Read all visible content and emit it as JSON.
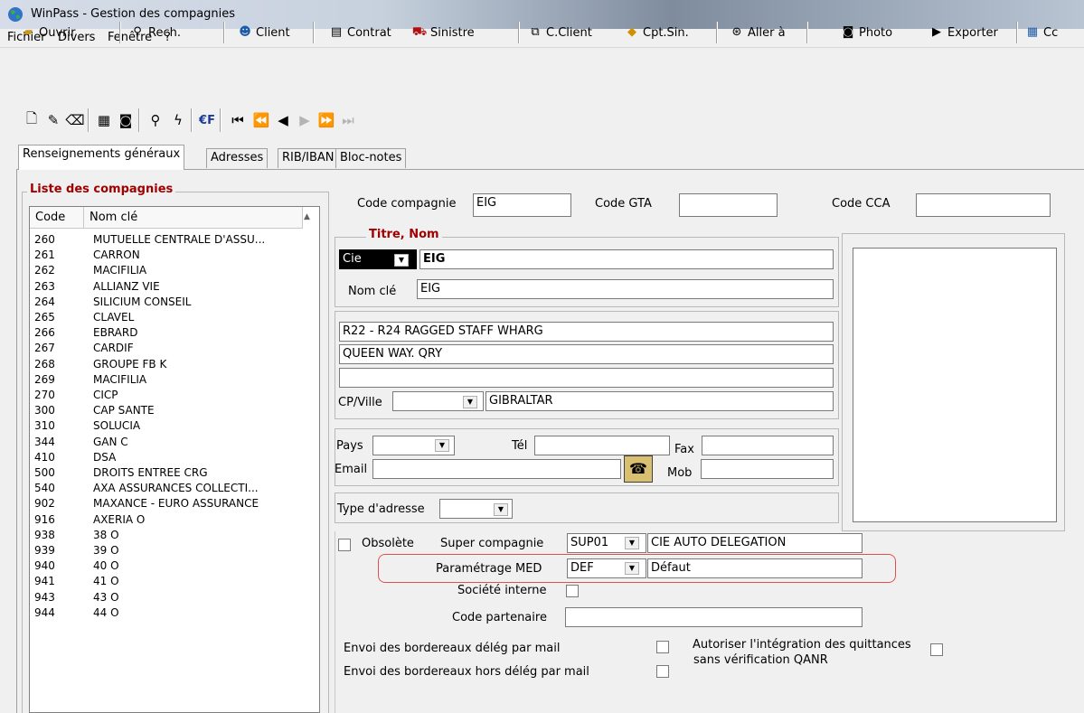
{
  "window": {
    "title": "WinPass - Gestion des compagnies"
  },
  "menu": [
    "Fichier",
    "Divers",
    "Fenêtre",
    "?"
  ],
  "toolbar": {
    "ouvrir": "Ouvrir",
    "rech": "Rech.",
    "client": "Client",
    "contrat": "Contrat",
    "sinistre": "Sinistre",
    "cclient": "C.Client",
    "cptsin": "Cpt.Sin.",
    "allera": "Aller à",
    "photo": "Photo",
    "exporter": "Exporter",
    "cc": "Cc"
  },
  "nav": {
    "euro_label": "€F"
  },
  "tabs": [
    "Renseignements généraux",
    "Adresses",
    "RIB/IBAN",
    "Bloc-notes"
  ],
  "list": {
    "title": "Liste des compagnies",
    "headers": [
      "Code",
      "Nom clé"
    ],
    "rows": [
      {
        "code": "260",
        "name": "MUTUELLE CENTRALE D'ASSU..."
      },
      {
        "code": "261",
        "name": "CARRON"
      },
      {
        "code": "262",
        "name": "MACIFILIA"
      },
      {
        "code": "263",
        "name": "ALLIANZ VIE"
      },
      {
        "code": "264",
        "name": "SILICIUM CONSEIL"
      },
      {
        "code": "265",
        "name": "CLAVEL"
      },
      {
        "code": "266",
        "name": "EBRARD"
      },
      {
        "code": "267",
        "name": "CARDIF"
      },
      {
        "code": "268",
        "name": "GROUPE FB  K"
      },
      {
        "code": "269",
        "name": "MACIFILIA"
      },
      {
        "code": "270",
        "name": "CICP"
      },
      {
        "code": "300",
        "name": "CAP SANTE"
      },
      {
        "code": "310",
        "name": "SOLUCIA"
      },
      {
        "code": "344",
        "name": "GAN C"
      },
      {
        "code": "410",
        "name": "DSA"
      },
      {
        "code": "500",
        "name": "DROITS ENTREE CRG"
      },
      {
        "code": "540",
        "name": "AXA ASSURANCES COLLECTI..."
      },
      {
        "code": "902",
        "name": "MAXANCE - EURO ASSURANCE"
      },
      {
        "code": "916",
        "name": "AXERIA O"
      },
      {
        "code": "938",
        "name": "38 O"
      },
      {
        "code": "939",
        "name": "39 O"
      },
      {
        "code": "940",
        "name": "40 O"
      },
      {
        "code": "941",
        "name": "41 O"
      },
      {
        "code": "943",
        "name": "43 O"
      },
      {
        "code": "944",
        "name": "44 O"
      }
    ]
  },
  "form": {
    "code_compagnie_label": "Code compagnie",
    "code_compagnie_value": "EIG",
    "code_gta_label": "Code GTA",
    "code_gta_value": "",
    "code_cca_label": "Code CCA",
    "code_cca_value": "",
    "titre_nom_label": "Titre,  Nom",
    "titre_value": "Cie",
    "nom_value": "EIG",
    "nom_cle_label": "Nom clé",
    "nom_cle_value": "EIG",
    "addr1": "R22 - R24 RAGGED STAFF WHARG",
    "addr2": "QUEEN WAY. QRY",
    "addr3": "",
    "cp_ville_label": "CP/Ville",
    "cp_value": "",
    "ville_value": "GIBRALTAR",
    "pays_label": "Pays",
    "pays_value": "",
    "tel_label": "Tél",
    "tel_value": "",
    "fax_label": "Fax",
    "fax_value": "",
    "email_label": "Email",
    "email_value": "",
    "mob_label": "Mob",
    "mob_value": "",
    "type_adresse_label": "Type d'adresse",
    "type_adresse_value": "",
    "obsolete_label": "Obsolète",
    "super_compagnie_label": "Super compagnie",
    "super_code": "SUP01",
    "super_name": "CIE AUTO DELEGATION",
    "parametrage_label": "Paramétrage MED",
    "param_code": "DEF",
    "param_name": "Défaut",
    "societe_interne_label": "Société interne",
    "code_partenaire_label": "Code partenaire",
    "code_partenaire_value": "",
    "envoi_deleg_label": "Envoi des bordereaux délég par mail",
    "envoi_hors_label": "Envoi des bordereaux hors délég par mail",
    "autoriser_label_1": "Autoriser l'intégration des quittances",
    "autoriser_label_2": "sans vérification QANR"
  }
}
